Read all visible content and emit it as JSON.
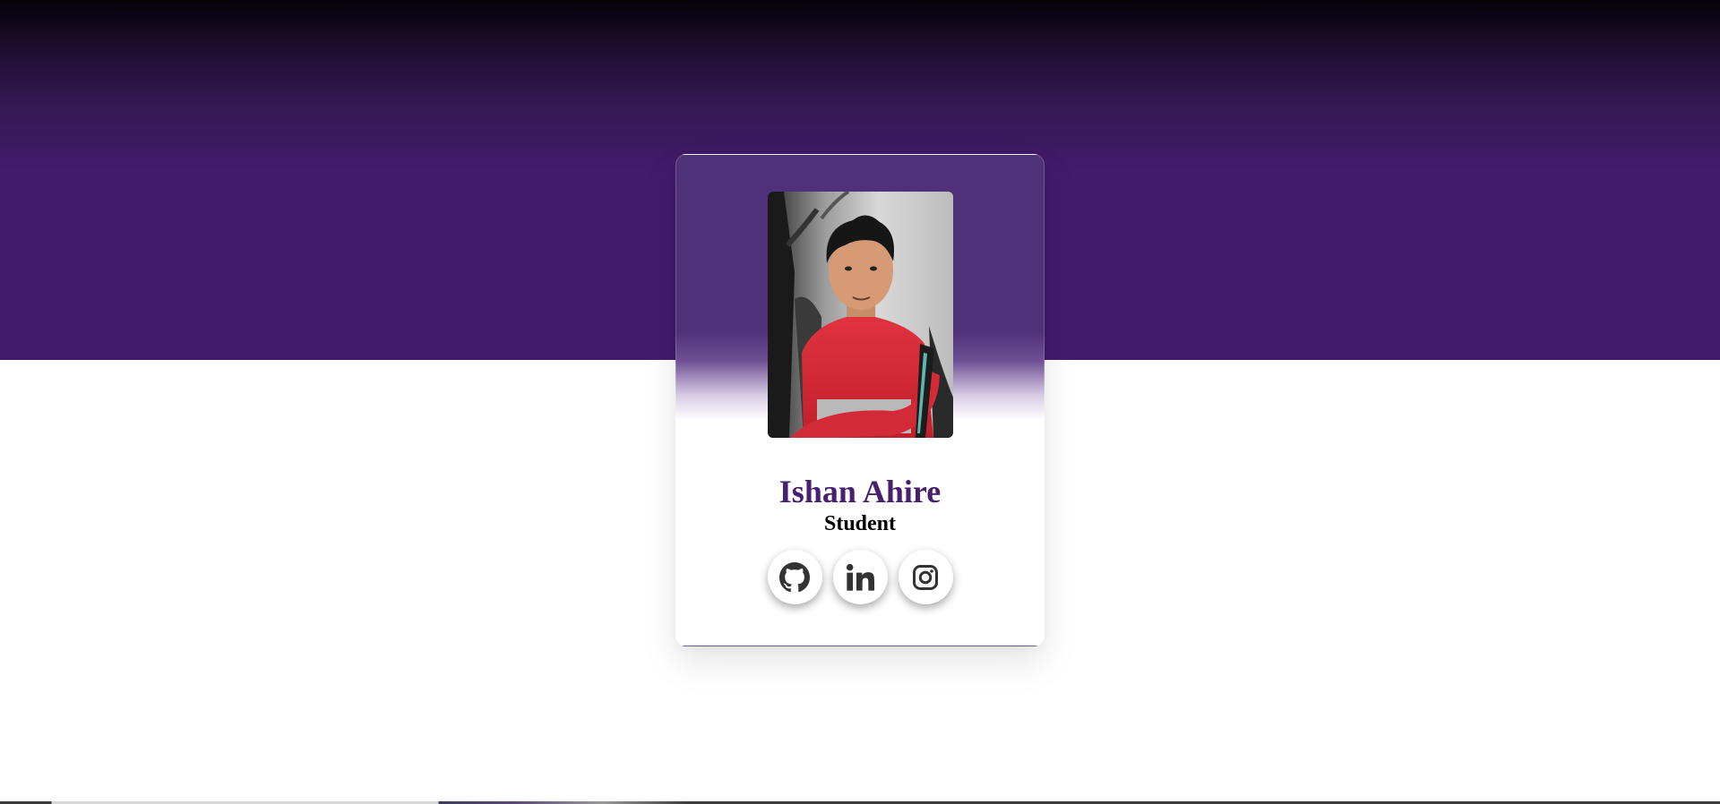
{
  "profile": {
    "name": "Ishan Ahire",
    "role": "Student",
    "photo_alt": "Profile photo"
  },
  "socials": [
    {
      "icon": "github-icon",
      "label": "GitHub"
    },
    {
      "icon": "linkedin-icon",
      "label": "LinkedIn"
    },
    {
      "icon": "instagram-icon",
      "label": "Instagram"
    }
  ],
  "colors": {
    "brand_purple": "#441a6c",
    "name_color": "#47206f",
    "icon_color": "#333333"
  }
}
